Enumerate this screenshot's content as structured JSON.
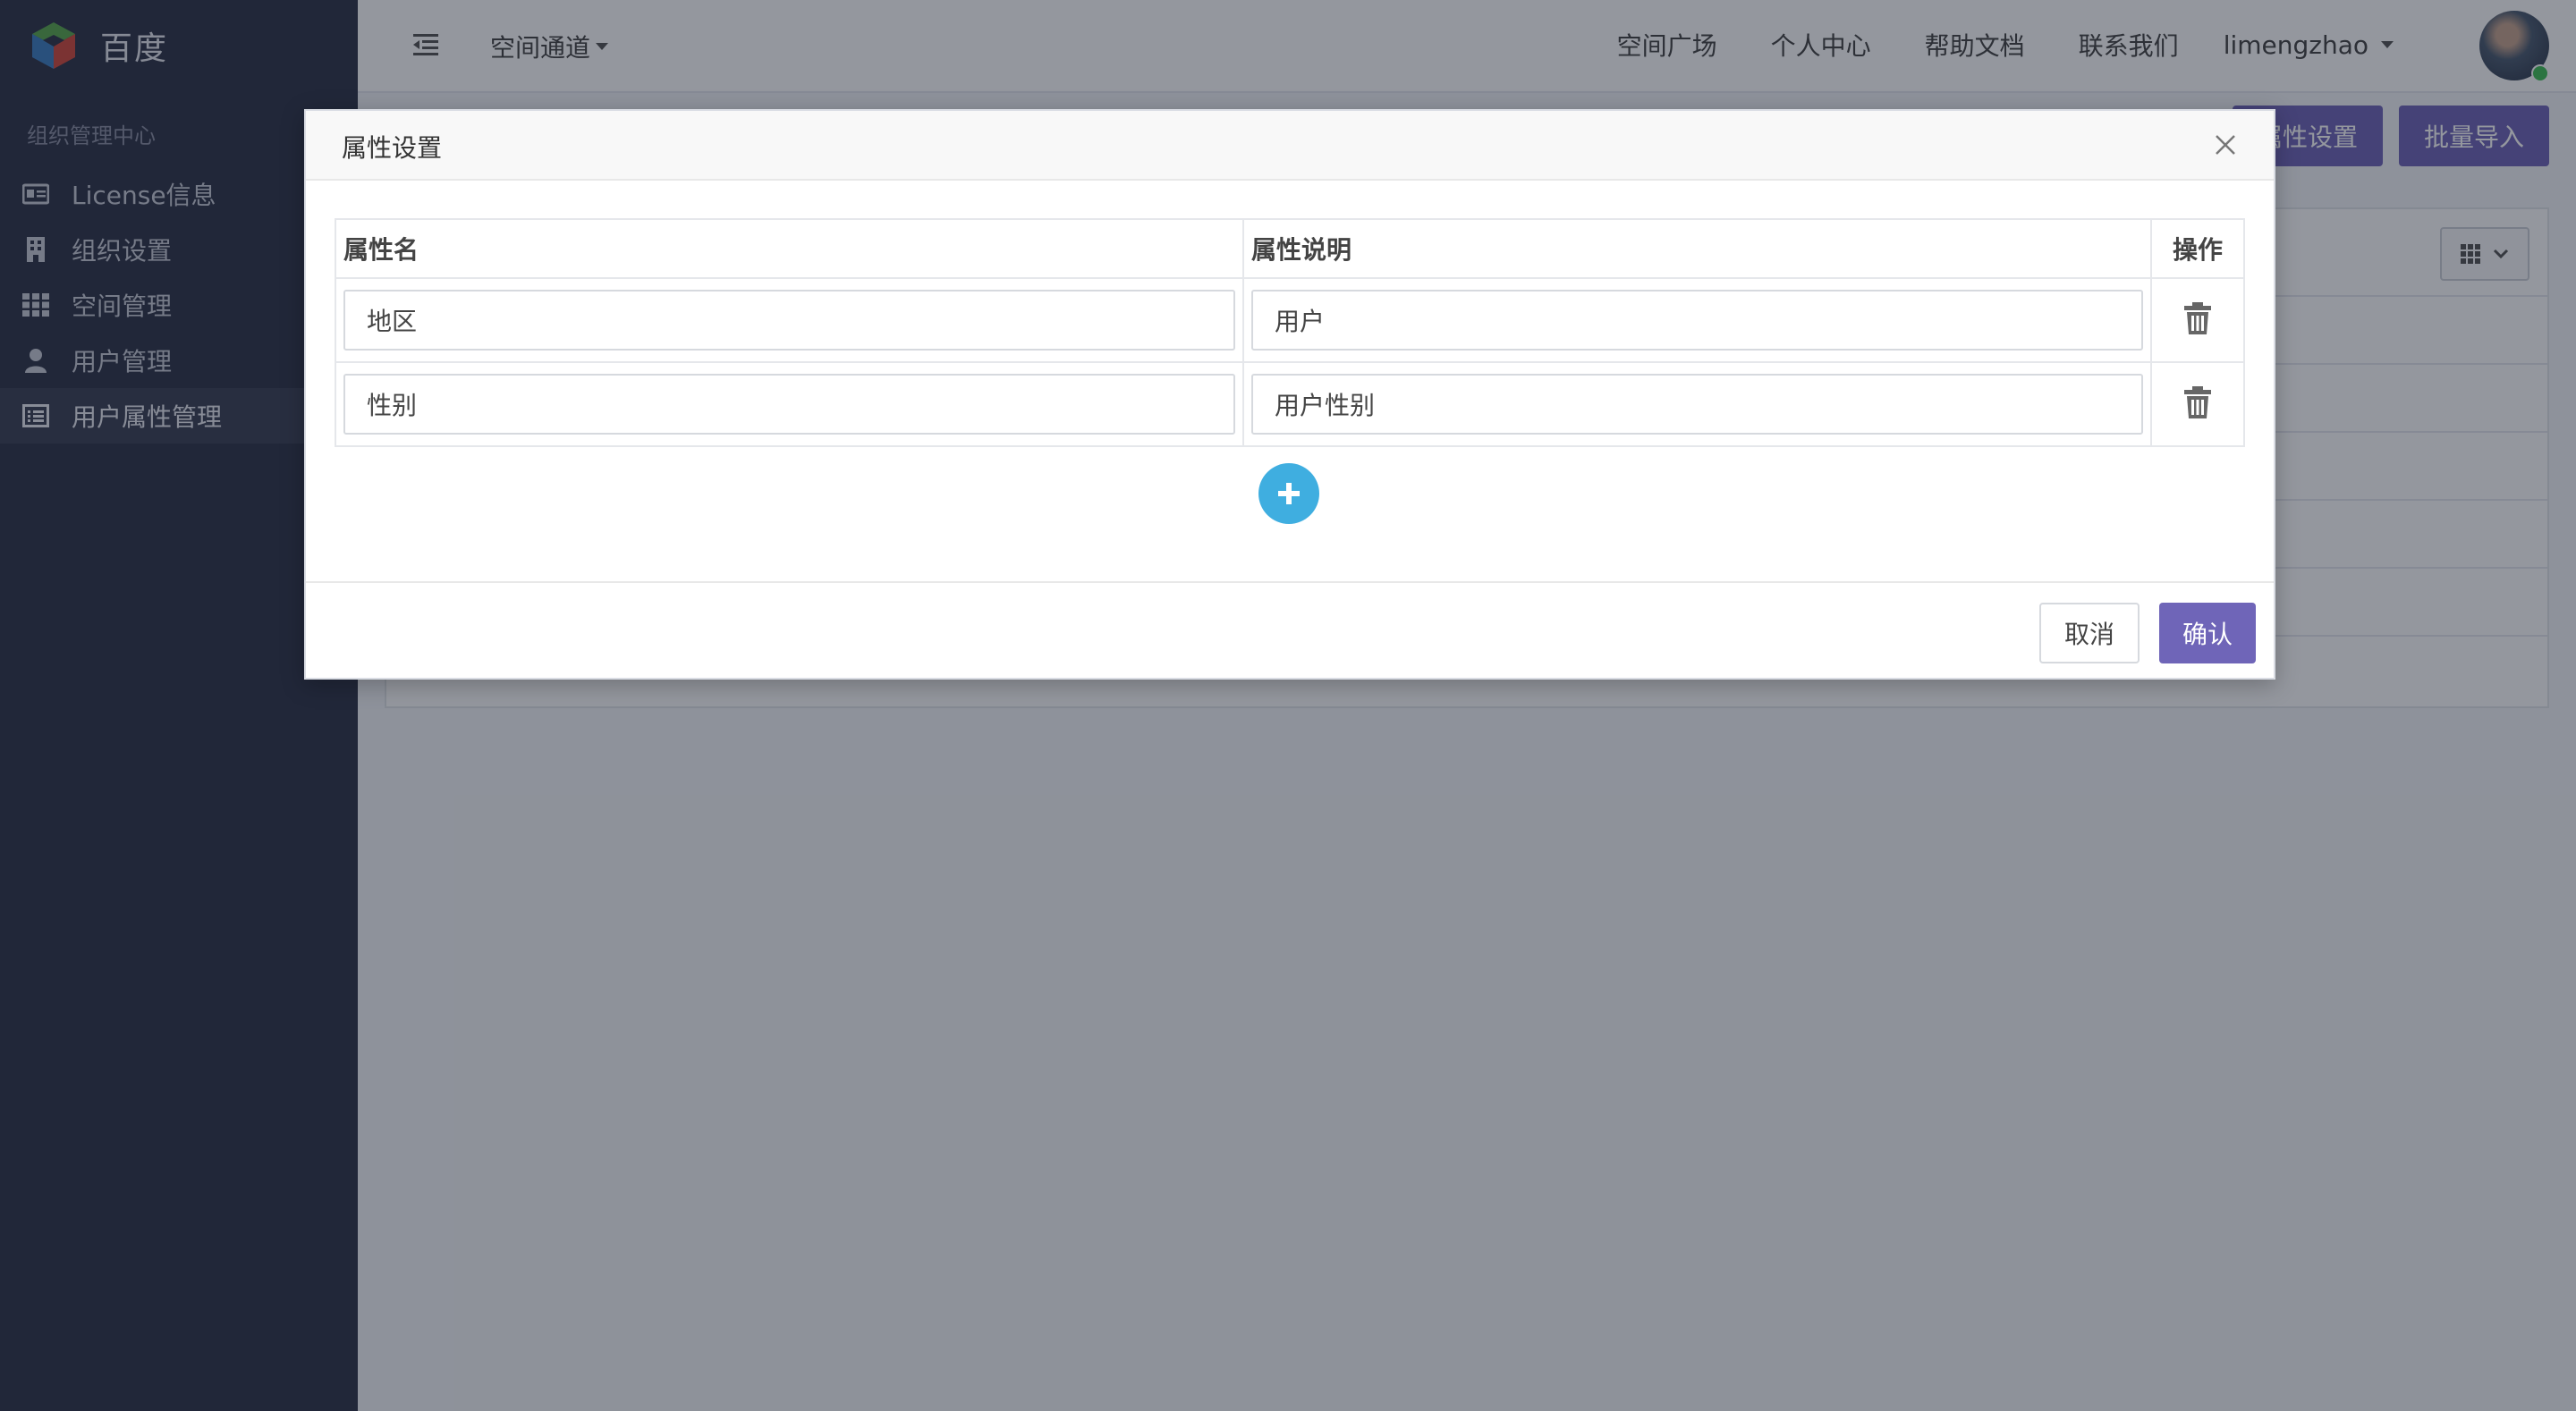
{
  "brand": {
    "name": "百度"
  },
  "sidebar": {
    "section_title": "组织管理中心",
    "items": [
      {
        "label": "License信息",
        "icon": "id-card-icon",
        "active": false
      },
      {
        "label": "组织设置",
        "icon": "building-icon",
        "active": false
      },
      {
        "label": "空间管理",
        "icon": "grid-icon",
        "active": false
      },
      {
        "label": "用户管理",
        "icon": "user-icon",
        "active": false
      },
      {
        "label": "用户属性管理",
        "icon": "list-icon",
        "active": true
      }
    ]
  },
  "header": {
    "space_channel": "空间通道",
    "links": [
      "空间广场",
      "个人中心",
      "帮助文档",
      "联系我们"
    ],
    "username": "limengzhao"
  },
  "page": {
    "attr_settings_button": "属性设置",
    "batch_import_button": "批量导入"
  },
  "modal": {
    "title": "属性设置",
    "columns": {
      "name": "属性名",
      "desc": "属性说明",
      "action": "操作"
    },
    "rows": [
      {
        "name": "地区",
        "desc": "用户"
      },
      {
        "name": "性别",
        "desc": "用户性别"
      }
    ],
    "cancel": "取消",
    "confirm": "确认"
  },
  "colors": {
    "sidebar_bg": "#2f3448",
    "primary": "#6f65b8",
    "add_button": "#3faee0"
  }
}
